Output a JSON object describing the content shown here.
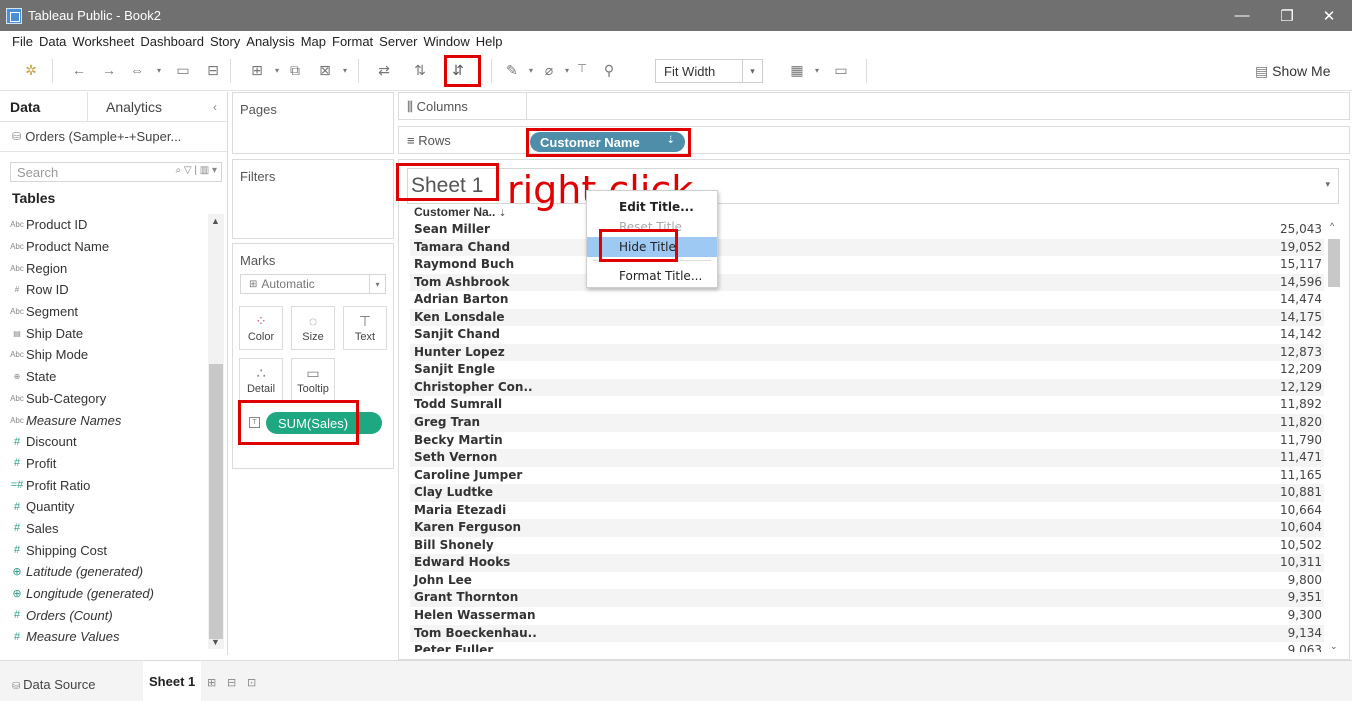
{
  "window": {
    "title": "Tableau Public - Book2",
    "minimize": "—",
    "restore": "❐",
    "close": "✕"
  },
  "menu": [
    "File",
    "Data",
    "Worksheet",
    "Dashboard",
    "Story",
    "Analysis",
    "Map",
    "Format",
    "Server",
    "Window",
    "Help"
  ],
  "toolbar": {
    "fit_label": "Fit Width",
    "show_me": "Show Me"
  },
  "data_pane": {
    "tab_data": "Data",
    "tab_analytics": "Analytics",
    "datasource": "Orders (Sample+-+Super...",
    "search_placeholder": "Search",
    "tables_heading": "Tables",
    "fields": [
      {
        "name": "Product ID",
        "type": "dimension",
        "icon": "Abc"
      },
      {
        "name": "Product Name",
        "type": "dimension",
        "icon": "Abc"
      },
      {
        "name": "Region",
        "type": "dimension",
        "icon": "Abc"
      },
      {
        "name": "Row ID",
        "type": "dimension",
        "icon": "#"
      },
      {
        "name": "Segment",
        "type": "dimension",
        "icon": "Abc"
      },
      {
        "name": "Ship Date",
        "type": "dimension",
        "icon": "▤"
      },
      {
        "name": "Ship Mode",
        "type": "dimension",
        "icon": "Abc"
      },
      {
        "name": "State",
        "type": "dimension",
        "icon": "⊕"
      },
      {
        "name": "Sub-Category",
        "type": "dimension",
        "icon": "Abc"
      },
      {
        "name": "Measure Names",
        "type": "dimension",
        "icon": "Abc",
        "italic": true
      },
      {
        "name": "Discount",
        "type": "measure",
        "icon": "#"
      },
      {
        "name": "Profit",
        "type": "measure",
        "icon": "#"
      },
      {
        "name": "Profit Ratio",
        "type": "measure",
        "icon": "=#"
      },
      {
        "name": "Quantity",
        "type": "measure",
        "icon": "#"
      },
      {
        "name": "Sales",
        "type": "measure",
        "icon": "#"
      },
      {
        "name": "Shipping Cost",
        "type": "measure",
        "icon": "#"
      },
      {
        "name": "Latitude (generated)",
        "type": "measure",
        "icon": "⊕",
        "italic": true
      },
      {
        "name": "Longitude (generated)",
        "type": "measure",
        "icon": "⊕",
        "italic": true
      },
      {
        "name": "Orders (Count)",
        "type": "measure",
        "icon": "#",
        "italic": true
      },
      {
        "name": "Measure Values",
        "type": "measure",
        "icon": "#",
        "italic": true
      }
    ]
  },
  "cards": {
    "pages": "Pages",
    "filters": "Filters",
    "marks": "Marks",
    "marks_type": "Automatic",
    "mark_buttons": [
      "Color",
      "Size",
      "Text",
      "Detail",
      "Tooltip"
    ],
    "sales_pill": "SUM(Sales)"
  },
  "shelves": {
    "columns": "Columns",
    "rows": "Rows",
    "row_pill": "Customer Name"
  },
  "viz": {
    "sheet_title": "Sheet 1",
    "annotation": "right click",
    "column_header": "Customer Na..",
    "rows": [
      {
        "name": "Sean Miller",
        "value": "25,043"
      },
      {
        "name": "Tamara Chand",
        "value": "19,052"
      },
      {
        "name": "Raymond Buch",
        "value": "15,117"
      },
      {
        "name": "Tom Ashbrook",
        "value": "14,596"
      },
      {
        "name": "Adrian Barton",
        "value": "14,474"
      },
      {
        "name": "Ken Lonsdale",
        "value": "14,175"
      },
      {
        "name": "Sanjit Chand",
        "value": "14,142"
      },
      {
        "name": "Hunter Lopez",
        "value": "12,873"
      },
      {
        "name": "Sanjit Engle",
        "value": "12,209"
      },
      {
        "name": "Christopher Con..",
        "value": "12,129"
      },
      {
        "name": "Todd Sumrall",
        "value": "11,892"
      },
      {
        "name": "Greg Tran",
        "value": "11,820"
      },
      {
        "name": "Becky Martin",
        "value": "11,790"
      },
      {
        "name": "Seth Vernon",
        "value": "11,471"
      },
      {
        "name": "Caroline Jumper",
        "value": "11,165"
      },
      {
        "name": "Clay Ludtke",
        "value": "10,881"
      },
      {
        "name": "Maria Etezadi",
        "value": "10,664"
      },
      {
        "name": "Karen Ferguson",
        "value": "10,604"
      },
      {
        "name": "Bill Shonely",
        "value": "10,502"
      },
      {
        "name": "Edward Hooks",
        "value": "10,311"
      },
      {
        "name": "John Lee",
        "value": "9,800"
      },
      {
        "name": "Grant Thornton",
        "value": "9,351"
      },
      {
        "name": "Helen Wasserman",
        "value": "9,300"
      },
      {
        "name": "Tom Boeckenhau..",
        "value": "9,134"
      },
      {
        "name": "Peter Fuller",
        "value": "9,063"
      }
    ]
  },
  "context_menu": {
    "items": [
      {
        "label": "Edit Title...",
        "state": "normal"
      },
      {
        "label": "Reset Title",
        "state": "disabled"
      },
      {
        "label": "Hide Title",
        "state": "highlighted"
      },
      {
        "label": "Format Title...",
        "state": "normal"
      }
    ]
  },
  "bottom": {
    "data_source": "Data Source",
    "sheet_tab": "Sheet 1"
  },
  "colors": {
    "titlebar": "#707070",
    "measure_pill": "#1ea882",
    "dimension_pill": "#4e8ea8",
    "annotation": "#e00000",
    "menu_highlight": "#9dc9f2"
  }
}
